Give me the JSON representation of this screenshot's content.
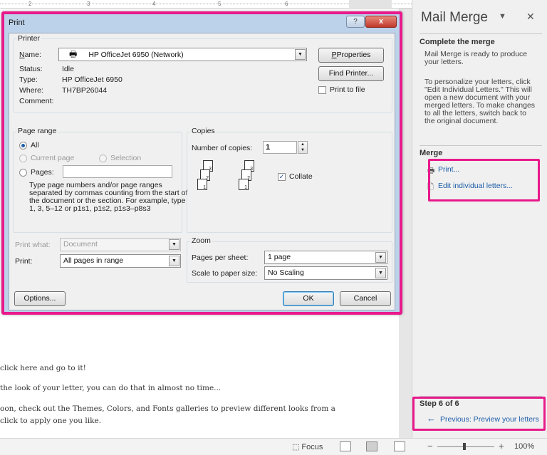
{
  "ruler": {
    "marks": [
      "2",
      "3",
      "4",
      "5",
      "6"
    ]
  },
  "document": {
    "lines": [
      "click here and go to it!",
      "the look of your letter, you can do that in almost no time...",
      "oon, check out the Themes, Colors, and Fonts galleries to preview different looks from a",
      " click to apply one you like."
    ]
  },
  "status_bar": {
    "focus_label": "Focus",
    "zoom_value": "100%"
  },
  "pane": {
    "title": "Mail Merge",
    "complete_heading": "Complete the merge",
    "ready_text": "Mail Merge is ready to produce your letters.",
    "personalize_text": "To personalize your letters, click \"Edit Individual Letters.\" This will open a new document with your merged letters. To make changes to all the letters, switch back to the original document.",
    "merge_heading": "Merge",
    "print_link": "Print...",
    "edit_link": "Edit individual letters...",
    "step_label": "Step 6 of 6",
    "previous_link": "Previous: Preview your letters"
  },
  "dialog": {
    "title": "Print",
    "help": "?",
    "close": "x",
    "printer": {
      "group_label": "Printer",
      "name_label": "Name:",
      "name_value": "HP OfficeJet 6950 (Network)",
      "status_label": "Status:",
      "status_value": "Idle",
      "type_label": "Type:",
      "type_value": "HP OfficeJet 6950",
      "where_label": "Where:",
      "where_value": "TH7BP26044",
      "comment_label": "Comment:",
      "properties_button": "Properties",
      "find_printer_button": "Find Printer...",
      "print_to_file_label": "Print to file"
    },
    "page_range": {
      "group_label": "Page range",
      "all_label": "All",
      "current_page_label": "Current page",
      "selection_label": "Selection",
      "pages_label": "Pages:",
      "pages_value": "",
      "hint": "Type page numbers and/or page ranges separated by commas counting from the start of the document or the section. For example, type 1, 3, 5–12 or p1s1, p1s2, p1s3–p8s3"
    },
    "copies": {
      "group_label": "Copies",
      "number_label": "Number of copies:",
      "number_value": "1",
      "collate_label": "Collate",
      "collate_checked": true
    },
    "print_what": {
      "label": "Print what:",
      "value": "Document"
    },
    "print": {
      "label": "Print:",
      "value": "All pages in range"
    },
    "zoom": {
      "group_label": "Zoom",
      "pages_per_sheet_label": "Pages per sheet:",
      "pages_per_sheet_value": "1 page",
      "scale_label": "Scale to paper size:",
      "scale_value": "No Scaling"
    },
    "options_button": "Options...",
    "ok_button": "OK",
    "cancel_button": "Cancel"
  },
  "colors": {
    "highlight": "#e8198b",
    "link": "#1d5da8"
  }
}
